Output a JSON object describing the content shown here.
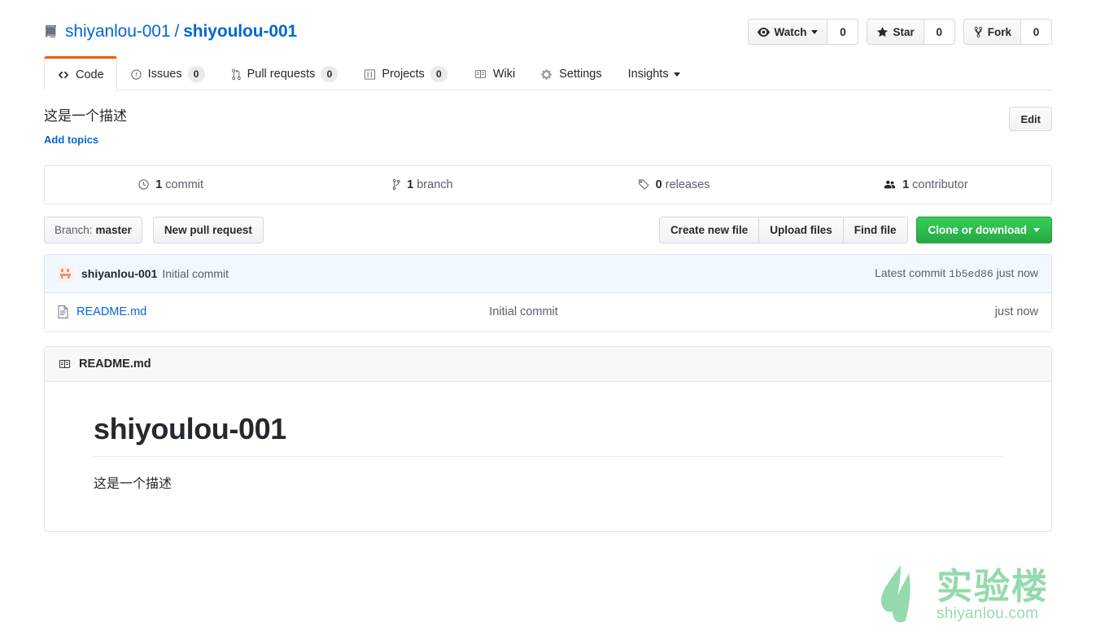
{
  "header": {
    "repo_icon": "repo-book-icon",
    "owner": "shiyanlou-001",
    "separator": "/",
    "name": "shiyoulou-001",
    "actions": [
      {
        "icon": "eye-icon",
        "label": "Watch",
        "count": "0",
        "has_caret": true
      },
      {
        "icon": "star-icon",
        "label": "Star",
        "count": "0",
        "has_caret": false
      },
      {
        "icon": "fork-icon",
        "label": "Fork",
        "count": "0",
        "has_caret": false
      }
    ]
  },
  "tabs": [
    {
      "icon": "code-icon",
      "label": "Code",
      "count": null,
      "active": true,
      "caret": false
    },
    {
      "icon": "issue-opened-icon",
      "label": "Issues",
      "count": "0",
      "active": false,
      "caret": false
    },
    {
      "icon": "git-pull-request-icon",
      "label": "Pull requests",
      "count": "0",
      "active": false,
      "caret": false
    },
    {
      "icon": "project-board-icon",
      "label": "Projects",
      "count": "0",
      "active": false,
      "caret": false
    },
    {
      "icon": "book-icon",
      "label": "Wiki",
      "count": null,
      "active": false,
      "caret": false
    },
    {
      "icon": "gear-icon",
      "label": "Settings",
      "count": null,
      "active": false,
      "caret": false
    },
    {
      "icon": null,
      "label": "Insights",
      "count": null,
      "active": false,
      "caret": true
    }
  ],
  "description": {
    "text": "这是一个描述",
    "add_topics_label": "Add topics",
    "edit_label": "Edit"
  },
  "stats": [
    {
      "icon": "history-icon",
      "value": "1",
      "label": "commit"
    },
    {
      "icon": "git-branch-icon",
      "value": "1",
      "label": "branch"
    },
    {
      "icon": "tag-icon",
      "value": "0",
      "label": "releases"
    },
    {
      "icon": "people-icon",
      "value": "1",
      "label": "contributor"
    }
  ],
  "toolbar": {
    "branch_prefix": "Branch:",
    "branch_name": "master",
    "new_pull_request_label": "New pull request",
    "create_new_file_label": "Create new file",
    "upload_files_label": "Upload files",
    "find_file_label": "Find file",
    "clone_label": "Clone or download"
  },
  "commit_bar": {
    "author": "shiyanlou-001",
    "message": "Initial commit",
    "latest_prefix": "Latest commit",
    "sha": "1b5ed86",
    "time": "just now"
  },
  "files": [
    {
      "icon": "file-icon",
      "name": "README.md",
      "message": "Initial commit",
      "time": "just now"
    }
  ],
  "readme": {
    "icon": "book-icon",
    "title": "README.md",
    "heading": "shiyoulou-001",
    "paragraph": "这是一个描述"
  },
  "watermark": {
    "cn": "实验楼",
    "en": "shiyanlou.com",
    "color": "#8fd9a8"
  },
  "colors": {
    "link": "#0366d6",
    "active_tab_border": "#e36209",
    "clone_green": "#28a745",
    "commit_bar_bg": "#f1f8ff",
    "border": "#e1e4e8"
  }
}
